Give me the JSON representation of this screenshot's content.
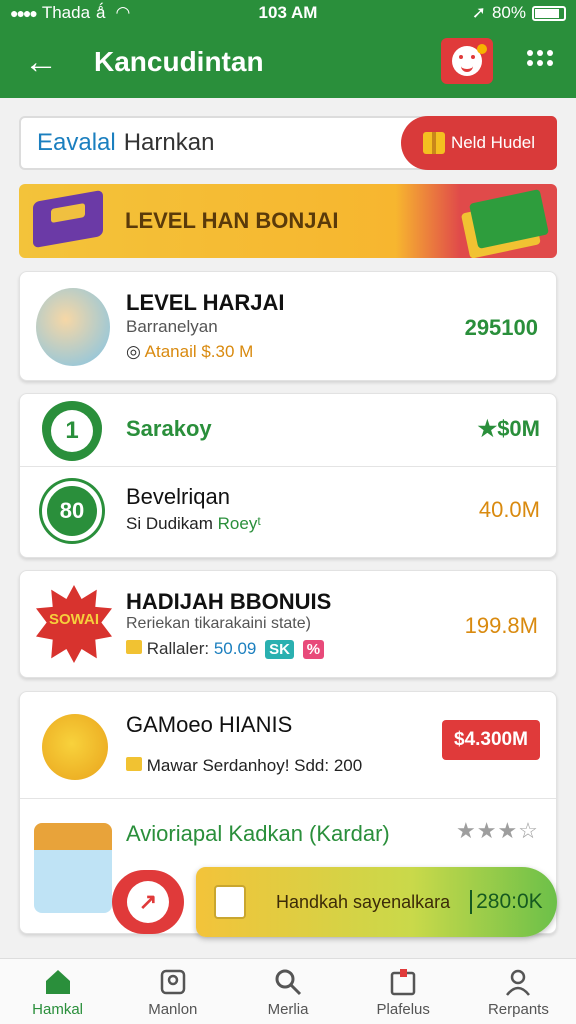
{
  "status_bar": {
    "carrier": "Thada",
    "extra": "ǻ",
    "time": "103 AM",
    "battery": "80%"
  },
  "app_bar": {
    "title": "Kancudintan"
  },
  "search": {
    "text_a": "Eavalal",
    "text_b": "Harnkan",
    "new_button_label": "Neld Hudel"
  },
  "banner": {
    "label": "LEVEL HAN BONJAI"
  },
  "level_card": {
    "title": "LEVEL HARJAI",
    "subtitle": "Barranelyan",
    "meta": "Atanail $.30 M",
    "amount": "295100"
  },
  "rank_card": {
    "rows": [
      {
        "badge": "1",
        "title": "Sarakoy",
        "amount": "★$0M"
      },
      {
        "badge": "80",
        "title": "Bevelriqan",
        "subtitle": "Si Dudikam",
        "subtitle_accent": "Roeyᵗ",
        "amount": "40.0M"
      }
    ]
  },
  "bonus_card": {
    "burst_text": "SOWAI",
    "title": "HADIJAH BBONUIS",
    "subtitle": "Reriekan tikarakaini state)",
    "meta_label": "Rallaler:",
    "meta_value": "50.09",
    "chip_a": "SK",
    "chip_b": "%",
    "amount": "199.8M"
  },
  "games_card": {
    "title": "GAMoeo HIANIS",
    "meta": "Mawar Serdanhoy! Sdd: 200",
    "price_button": "$4.300M",
    "row2_title": "Avioriapal Kadkan (Kardar)",
    "row2_stars": "★★★☆"
  },
  "float_bar": {
    "label": "Handkah sayenalkara",
    "value": "280:0K"
  },
  "tabs": [
    {
      "label": "Hamkal",
      "icon": "home-icon"
    },
    {
      "label": "Manlon",
      "icon": "profile-card-icon"
    },
    {
      "label": "Merlia",
      "icon": "search-icon"
    },
    {
      "label": "Plafelus",
      "icon": "calendar-icon"
    },
    {
      "label": "Rerpants",
      "icon": "person-icon"
    }
  ],
  "colors": {
    "primary": "#2a8f3b",
    "accent_red": "#e03a3a",
    "gold": "#f3c33a"
  }
}
